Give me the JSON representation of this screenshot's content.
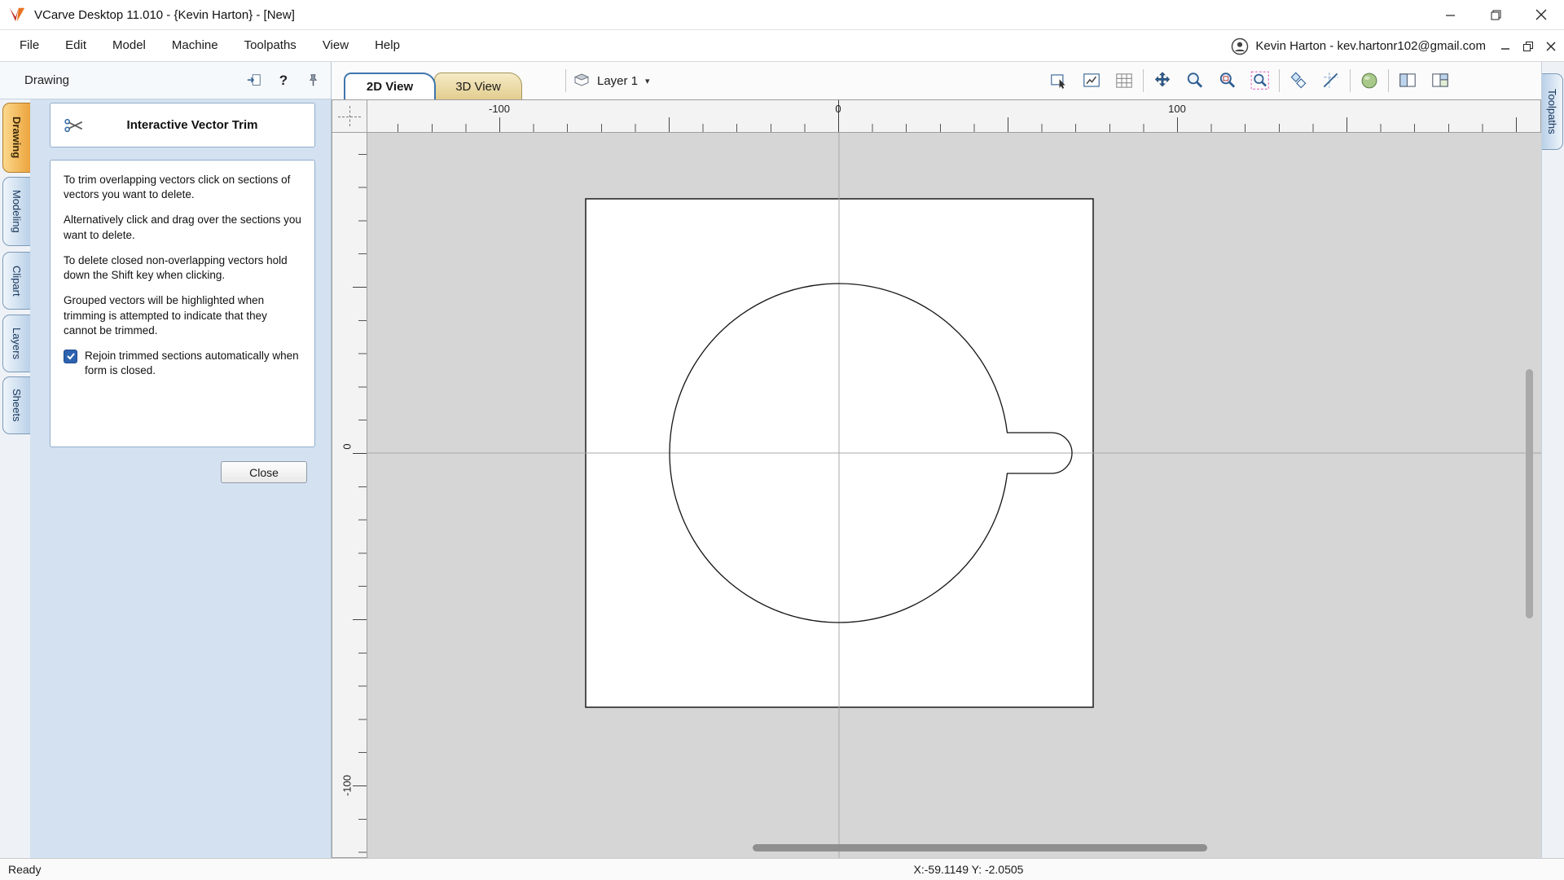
{
  "window": {
    "title": "VCarve Desktop 11.010 - {Kevin Harton} - [New]",
    "controls": [
      "minimize-icon",
      "maximize-icon",
      "close-icon"
    ]
  },
  "menu": {
    "items": [
      "File",
      "Edit",
      "Model",
      "Machine",
      "Toolpaths",
      "View",
      "Help"
    ],
    "account": "Kevin Harton - kev.hartonr102@gmail.com",
    "child_controls": [
      "minimize-icon",
      "restore-icon",
      "close-icon"
    ]
  },
  "side_tabs": {
    "left": [
      "Drawing",
      "Modeling",
      "Clipart",
      "Layers",
      "Sheets"
    ],
    "active_left": "Drawing",
    "right": [
      "Toolpaths"
    ]
  },
  "panel": {
    "header": "Drawing",
    "header_icons": [
      "undock-icon",
      "help-icon",
      "pin-icon"
    ],
    "tool_icon": "scissors-icon",
    "tool_title": "Interactive Vector Trim",
    "paragraphs": [
      "To trim overlapping vectors click on sections of vectors you want to delete.",
      "Alternatively click and drag over the sections you want to delete.",
      "To delete closed non-overlapping vectors hold down the Shift key when clicking.",
      "Grouped vectors will be highlighted when trimming is attempted to indicate that they cannot be trimmed."
    ],
    "checkbox": {
      "label": "Rejoin trimmed sections automatically when form is closed.",
      "checked": true
    },
    "close_label": "Close"
  },
  "view": {
    "tabs": [
      "2D View",
      "3D View"
    ],
    "active_tab": "2D View",
    "layer": "Layer 1"
  },
  "toolbar": {
    "icons": [
      "zoom-box",
      "zoom-drawing",
      "grid-toggle",
      "pan-tool",
      "zoom-tool",
      "zoom-window-tool",
      "zoom-selected-tool",
      "snap-settings",
      "guides-toggle",
      "shading-toggle",
      "tile-horizontal",
      "tile-vertical"
    ]
  },
  "rulers": {
    "horizontal": [
      "-100",
      "0",
      "100"
    ],
    "vertical": [
      "0",
      "-100"
    ]
  },
  "status": {
    "left": "Ready",
    "coords": "X:-59.1149 Y: -2.0505"
  },
  "colors": {
    "active_side_tab": "#eca43e",
    "panel_bg": "#d3e1f0",
    "canvas_bg": "#d6d6d6",
    "checkbox_blue": "#2d62b0",
    "tab_border_blue": "#3f76ad"
  }
}
